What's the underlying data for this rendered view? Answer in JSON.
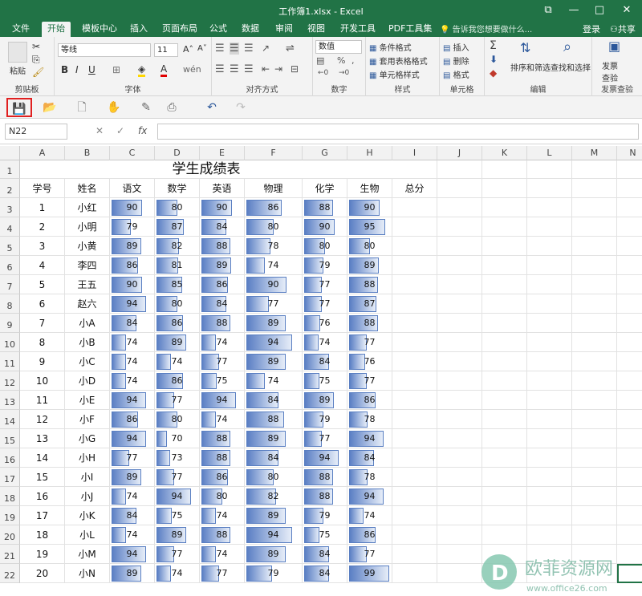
{
  "window": {
    "title": "工作簿1.xlsx - Excel",
    "restore_icon": "⧉",
    "minimize_icon": "—",
    "maximize_icon": "□",
    "close_icon": "✕"
  },
  "tabs": [
    "文件",
    "开始",
    "模板中心",
    "插入",
    "页面布局",
    "公式",
    "数据",
    "审阅",
    "视图",
    "开发工具",
    "PDF工具集"
  ],
  "tell_me": "告诉我您想要做什么...",
  "login": "登录",
  "share": "共享",
  "ribbon": {
    "clipboard": {
      "label": "剪贴板",
      "paste": "粘贴"
    },
    "font": {
      "label": "字体",
      "name": "等线",
      "size": "11"
    },
    "alignment": {
      "label": "对齐方式"
    },
    "number": {
      "label": "数字",
      "format": "数值"
    },
    "styles": {
      "label": "样式",
      "conditional": "条件格式",
      "table": "套用表格格式",
      "cell_styles": "单元格样式"
    },
    "cells": {
      "label": "单元格",
      "insert": "插入",
      "delete": "删除",
      "format": "格式"
    },
    "editing": {
      "label": "编辑",
      "sort": "排序和筛选",
      "find": "查找和选择"
    },
    "invoice": {
      "label": "发票查验",
      "btn": "发票\n查验"
    }
  },
  "formula_bar": {
    "name_box": "N22",
    "fx": "fx",
    "cancel": "✕",
    "enter": "✓"
  },
  "columns": [
    "A",
    "B",
    "C",
    "D",
    "E",
    "F",
    "G",
    "H",
    "I",
    "J",
    "K",
    "L",
    "M",
    "N"
  ],
  "sheet": {
    "title": "学生成绩表",
    "headers": [
      "学号",
      "姓名",
      "语文",
      "数学",
      "英语",
      "物理",
      "化学",
      "生物",
      "总分"
    ],
    "rows": [
      {
        "id": "1",
        "name": "小红",
        "scores": [
          90,
          80,
          90,
          86,
          88,
          90
        ]
      },
      {
        "id": "2",
        "name": "小明",
        "scores": [
          79,
          87,
          84,
          80,
          90,
          95
        ]
      },
      {
        "id": "3",
        "name": "小黄",
        "scores": [
          89,
          82,
          88,
          78,
          80,
          80
        ]
      },
      {
        "id": "4",
        "name": "李四",
        "scores": [
          86,
          81,
          89,
          74,
          79,
          89
        ]
      },
      {
        "id": "5",
        "name": "王五",
        "scores": [
          90,
          85,
          86,
          90,
          77,
          88
        ]
      },
      {
        "id": "6",
        "name": "赵六",
        "scores": [
          94,
          80,
          84,
          77,
          77,
          87
        ]
      },
      {
        "id": "7",
        "name": "小A",
        "scores": [
          84,
          86,
          88,
          89,
          76,
          88
        ]
      },
      {
        "id": "8",
        "name": "小B",
        "scores": [
          74,
          89,
          74,
          94,
          74,
          77
        ]
      },
      {
        "id": "9",
        "name": "小C",
        "scores": [
          74,
          74,
          77,
          89,
          84,
          76
        ]
      },
      {
        "id": "10",
        "name": "小D",
        "scores": [
          74,
          86,
          75,
          74,
          75,
          77
        ]
      },
      {
        "id": "11",
        "name": "小E",
        "scores": [
          94,
          77,
          94,
          84,
          89,
          86
        ]
      },
      {
        "id": "12",
        "name": "小F",
        "scores": [
          86,
          80,
          74,
          88,
          79,
          78
        ]
      },
      {
        "id": "13",
        "name": "小G",
        "scores": [
          94,
          70,
          88,
          89,
          77,
          94
        ]
      },
      {
        "id": "14",
        "name": "小H",
        "scores": [
          77,
          73,
          88,
          84,
          94,
          84
        ]
      },
      {
        "id": "15",
        "name": "小I",
        "scores": [
          89,
          77,
          86,
          80,
          88,
          78
        ]
      },
      {
        "id": "16",
        "name": "小J",
        "scores": [
          74,
          94,
          80,
          82,
          88,
          94
        ]
      },
      {
        "id": "17",
        "name": "小K",
        "scores": [
          84,
          75,
          74,
          89,
          79,
          74
        ]
      },
      {
        "id": "18",
        "name": "小L",
        "scores": [
          74,
          89,
          88,
          94,
          75,
          86
        ]
      },
      {
        "id": "19",
        "name": "小M",
        "scores": [
          94,
          77,
          74,
          89,
          84,
          77
        ]
      },
      {
        "id": "20",
        "name": "小N",
        "scores": [
          89,
          74,
          77,
          79,
          84,
          99
        ]
      }
    ]
  },
  "databar": {
    "min": 60,
    "max": 100,
    "color": "#5b7fc4"
  },
  "watermark": {
    "text": "欧菲资源网",
    "url": "www.office26.com"
  }
}
